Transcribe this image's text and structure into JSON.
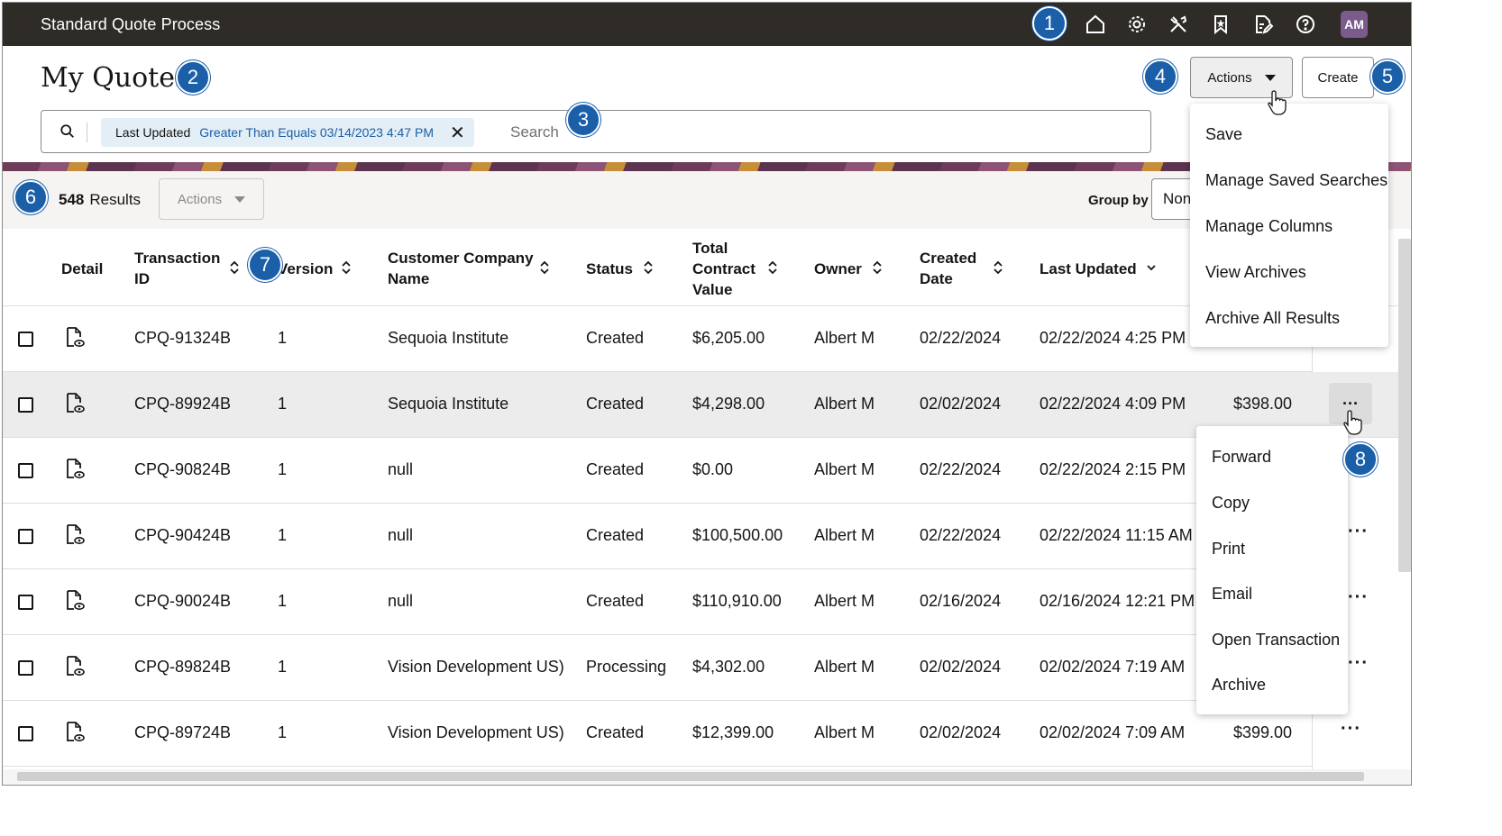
{
  "app": {
    "title": "Standard Quote Process"
  },
  "topbar": {
    "icons": [
      "home-icon",
      "gear-icon",
      "tools-icon",
      "bookmark-icon",
      "edit-document-icon",
      "help-icon"
    ],
    "avatar_initials": "AM"
  },
  "page": {
    "title": "My Quotes"
  },
  "toolbar": {
    "actions_label": "Actions",
    "create_label": "Create"
  },
  "search": {
    "chip_label": "Last Updated",
    "chip_value": "Greater Than Equals 03/14/2023 4:47 PM",
    "placeholder": "Search"
  },
  "results": {
    "count": "548",
    "label": "Results",
    "actions_label": "Actions",
    "group_by_label": "Group by",
    "group_by_value": "None"
  },
  "table": {
    "headers": {
      "detail": "Detail",
      "transaction_id_1": "Transaction",
      "transaction_id_2": "ID",
      "version": "Version",
      "customer_1": "Customer Company",
      "customer_2": "Name",
      "status": "Status",
      "total_1": "Total",
      "total_2": "Contract",
      "total_3": "Value",
      "owner": "Owner",
      "created_1": "Created",
      "created_2": "Date",
      "last_updated": "Last Updated"
    },
    "rows": [
      {
        "id": "CPQ-91324B",
        "version": "1",
        "customer": "Sequoia Institute",
        "status": "Created",
        "total": "$6,205.00",
        "owner": "Albert M",
        "created": "02/22/2024",
        "updated": "02/22/2024 4:25 PM",
        "extra": ""
      },
      {
        "id": "CPQ-89924B",
        "version": "1",
        "customer": "Sequoia Institute",
        "status": "Created",
        "total": "$4,298.00",
        "owner": "Albert M",
        "created": "02/02/2024",
        "updated": "02/22/2024 4:09 PM",
        "extra": "$398.00"
      },
      {
        "id": "CPQ-90824B",
        "version": "1",
        "customer": "null",
        "status": "Created",
        "total": "$0.00",
        "owner": "Albert M",
        "created": "02/22/2024",
        "updated": "02/22/2024 2:15 PM",
        "extra": ""
      },
      {
        "id": "CPQ-90424B",
        "version": "1",
        "customer": "null",
        "status": "Created",
        "total": "$100,500.00",
        "owner": "Albert M",
        "created": "02/22/2024",
        "updated": "02/22/2024 11:15 AM",
        "extra": ""
      },
      {
        "id": "CPQ-90024B",
        "version": "1",
        "customer": "null",
        "status": "Created",
        "total": "$110,910.00",
        "owner": "Albert M",
        "created": "02/16/2024",
        "updated": "02/16/2024 12:21 PM",
        "extra": ""
      },
      {
        "id": "CPQ-89824B",
        "version": "1",
        "customer": "Vision Development US)",
        "status": "Processing",
        "total": "$4,302.00",
        "owner": "Albert M",
        "created": "02/02/2024",
        "updated": "02/02/2024 7:19 AM",
        "extra": ""
      },
      {
        "id": "CPQ-89724B",
        "version": "1",
        "customer": "Vision Development US)",
        "status": "Created",
        "total": "$12,399.00",
        "owner": "Albert M",
        "created": "02/02/2024",
        "updated": "02/02/2024 7:09 AM",
        "extra": "$399.00"
      }
    ]
  },
  "actions_menu": {
    "items": [
      "Save",
      "Manage Saved Searches",
      "Manage Columns",
      "View Archives",
      "Archive All Results"
    ]
  },
  "row_menu": {
    "items": [
      "Forward",
      "Copy",
      "Print",
      "Email",
      "Open Transaction",
      "Archive"
    ]
  },
  "callouts": [
    "1",
    "2",
    "3",
    "4",
    "5",
    "6",
    "7",
    "8"
  ],
  "colors": {
    "topbar": "#2f2c28",
    "badge": "#1a5fa8",
    "chip_bg": "#e3eef6",
    "chip_text": "#1a5fa8",
    "avatar": "#7b5a8c"
  }
}
